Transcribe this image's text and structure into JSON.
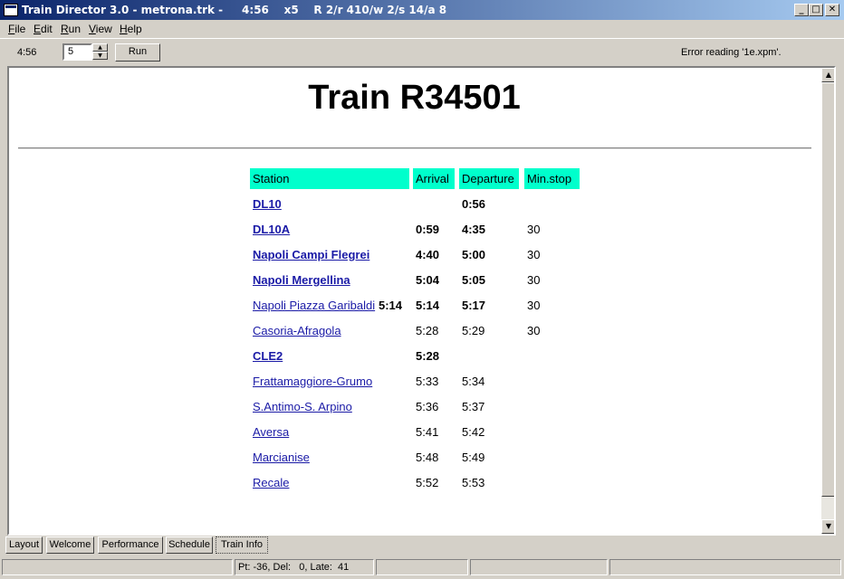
{
  "window": {
    "title": "Train Director 3.0 - metrona.trk -     4:56    x5    R 2/r 410/w 2/s 14/a 8",
    "min": "_",
    "max": "□",
    "close": "✕"
  },
  "menu": [
    "File",
    "Edit",
    "Run",
    "View",
    "Help"
  ],
  "toolbar": {
    "clock": "4:56",
    "speed": "5",
    "run_label": "Run",
    "error": "Error reading '1e.xpm'."
  },
  "page": {
    "title": "Train R34501"
  },
  "table": {
    "headers": {
      "station": "Station",
      "arrival": "Arrival",
      "departure": "Departure",
      "minstop": "Min.stop"
    },
    "rows": [
      {
        "station": "DL10",
        "extra": "",
        "arrival": "",
        "departure": "0:56",
        "minstop": "",
        "bold": true
      },
      {
        "station": "DL10A",
        "extra": "",
        "arrival": "0:59",
        "departure": "4:35",
        "minstop": "30",
        "bold": true
      },
      {
        "station": "Napoli Campi Flegrei",
        "extra": "",
        "arrival": "4:40",
        "departure": "5:00",
        "minstop": "30",
        "bold": true
      },
      {
        "station": "Napoli Mergellina",
        "extra": "",
        "arrival": "5:04",
        "departure": "5:05",
        "minstop": "30",
        "bold": true
      },
      {
        "station": "Napoli Piazza Garibaldi",
        "extra": "5:14",
        "arrival": "5:14",
        "departure": "5:17",
        "minstop": "30",
        "bold": false,
        "times_bold": true
      },
      {
        "station": "Casoria-Afragola",
        "extra": "",
        "arrival": "5:28",
        "departure": "5:29",
        "minstop": "30",
        "bold": false
      },
      {
        "station": "CLE2",
        "extra": "",
        "arrival": "5:28",
        "departure": "",
        "minstop": "",
        "bold": true
      },
      {
        "station": "Frattamaggiore-Grumo",
        "extra": "",
        "arrival": "5:33",
        "departure": "5:34",
        "minstop": "",
        "bold": false
      },
      {
        "station": "S.Antimo-S. Arpino",
        "extra": "",
        "arrival": "5:36",
        "departure": "5:37",
        "minstop": "",
        "bold": false
      },
      {
        "station": "Aversa",
        "extra": "",
        "arrival": "5:41",
        "departure": "5:42",
        "minstop": "",
        "bold": false
      },
      {
        "station": "Marcianise",
        "extra": "",
        "arrival": "5:48",
        "departure": "5:49",
        "minstop": "",
        "bold": false
      },
      {
        "station": "Recale",
        "extra": "",
        "arrival": "5:52",
        "departure": "5:53",
        "minstop": "",
        "bold": false
      }
    ]
  },
  "tabs": [
    "Layout",
    "Welcome",
    "Performance",
    "Schedule",
    "Train Info"
  ],
  "active_tab": "Train Info",
  "status": {
    "stats": "Pt: -36, Del:   0, Late:  41"
  },
  "colors": {
    "header_bg": "#00ffcc",
    "link": "#1a1aa6",
    "titlebar": "#0a246a"
  }
}
